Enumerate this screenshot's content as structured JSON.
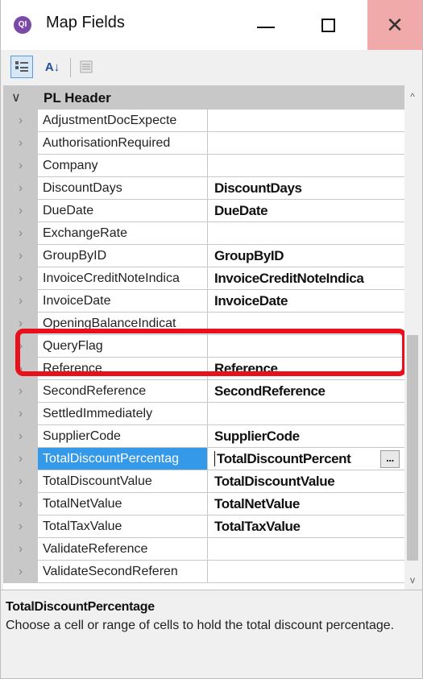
{
  "window": {
    "title": "Map Fields",
    "app_icon_text": "QI"
  },
  "toolbar": {
    "alpha_sort_label": "A↓"
  },
  "grid": {
    "category": "PL Header",
    "rows": [
      {
        "name": "AdjustmentDocExpecte",
        "value": ""
      },
      {
        "name": "AuthorisationRequired",
        "value": ""
      },
      {
        "name": "Company",
        "value": ""
      },
      {
        "name": "DiscountDays",
        "value": "DiscountDays"
      },
      {
        "name": "DueDate",
        "value": "DueDate"
      },
      {
        "name": "ExchangeRate",
        "value": ""
      },
      {
        "name": "GroupByID",
        "value": "GroupByID"
      },
      {
        "name": "InvoiceCreditNoteIndica",
        "value": "InvoiceCreditNoteIndica"
      },
      {
        "name": "InvoiceDate",
        "value": "InvoiceDate"
      },
      {
        "name": "OpeningBalanceIndicat",
        "value": ""
      },
      {
        "name": "QueryFlag",
        "value": ""
      },
      {
        "name": "Reference",
        "value": "Reference"
      },
      {
        "name": "SecondReference",
        "value": "SecondReference"
      },
      {
        "name": "SettledImmediately",
        "value": ""
      },
      {
        "name": "SupplierCode",
        "value": "SupplierCode"
      },
      {
        "name": "TotalDiscountPercentag",
        "value": "TotalDiscountPercent",
        "selected": true
      },
      {
        "name": "TotalDiscountValue",
        "value": "TotalDiscountValue"
      },
      {
        "name": "TotalNetValue",
        "value": "TotalNetValue"
      },
      {
        "name": "TotalTaxValue",
        "value": "TotalTaxValue"
      },
      {
        "name": "ValidateReference",
        "value": ""
      },
      {
        "name": "ValidateSecondReferen",
        "value": ""
      }
    ],
    "ellipsis_label": "..."
  },
  "description": {
    "title": "TotalDiscountPercentage",
    "body": "Choose a cell or range of cells to hold the total discount percentage."
  },
  "colors": {
    "selection": "#3399e8",
    "highlight_box": "#e8101a",
    "close_button": "#f1aaaa"
  }
}
